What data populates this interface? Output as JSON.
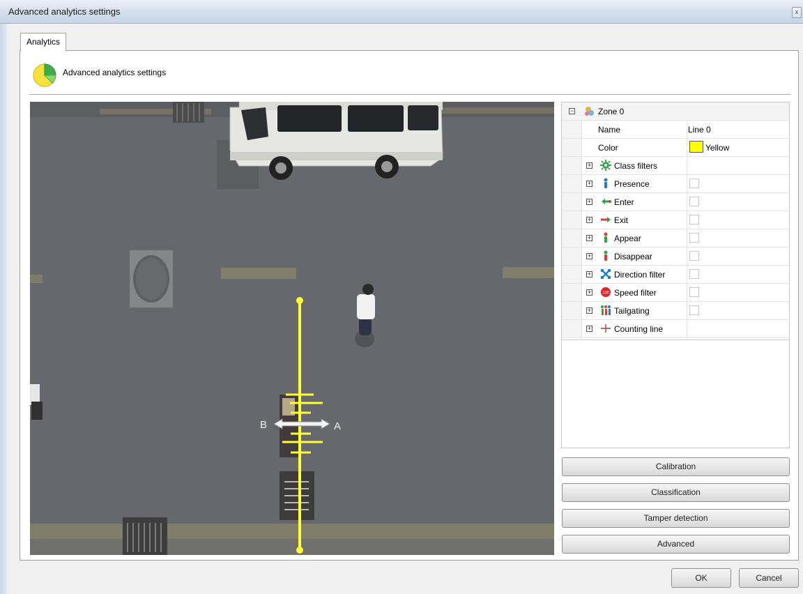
{
  "window": {
    "title": "Advanced analytics settings",
    "close_glyph": "x"
  },
  "tab": {
    "label": "Analytics"
  },
  "header": {
    "icon": "pie-chart-icon",
    "text": "Advanced analytics settings"
  },
  "video": {
    "direction_left": "B",
    "direction_right": "A",
    "line_color": "#ffff33"
  },
  "properties": {
    "zone": {
      "label": "Zone 0",
      "expander": "−",
      "icon": "zone-icon"
    },
    "name_label": "Name",
    "name_value": "Line 0",
    "color_label": "Color",
    "color_value": "Yellow",
    "color_hex": "#ffff00",
    "items": [
      {
        "label": "Class filters",
        "icon": "gear-icon",
        "checkbox": false
      },
      {
        "label": "Presence",
        "icon": "presence-icon",
        "checkbox": true
      },
      {
        "label": "Enter",
        "icon": "enter-icon",
        "checkbox": true
      },
      {
        "label": "Exit",
        "icon": "exit-icon",
        "checkbox": true
      },
      {
        "label": "Appear",
        "icon": "appear-icon",
        "checkbox": true
      },
      {
        "label": "Disappear",
        "icon": "disappear-icon",
        "checkbox": true
      },
      {
        "label": "Direction filter",
        "icon": "direction-icon",
        "checkbox": true
      },
      {
        "label": "Speed filter",
        "icon": "speed-icon",
        "checkbox": true
      },
      {
        "label": "Tailgating",
        "icon": "tailgating-icon",
        "checkbox": true
      },
      {
        "label": "Counting line",
        "icon": "counting-line-icon",
        "checkbox": false
      }
    ],
    "expander": "+"
  },
  "buttons": {
    "calibration": "Calibration",
    "classification": "Classification",
    "tamper": "Tamper detection",
    "advanced": "Advanced",
    "ok": "OK",
    "cancel": "Cancel"
  }
}
